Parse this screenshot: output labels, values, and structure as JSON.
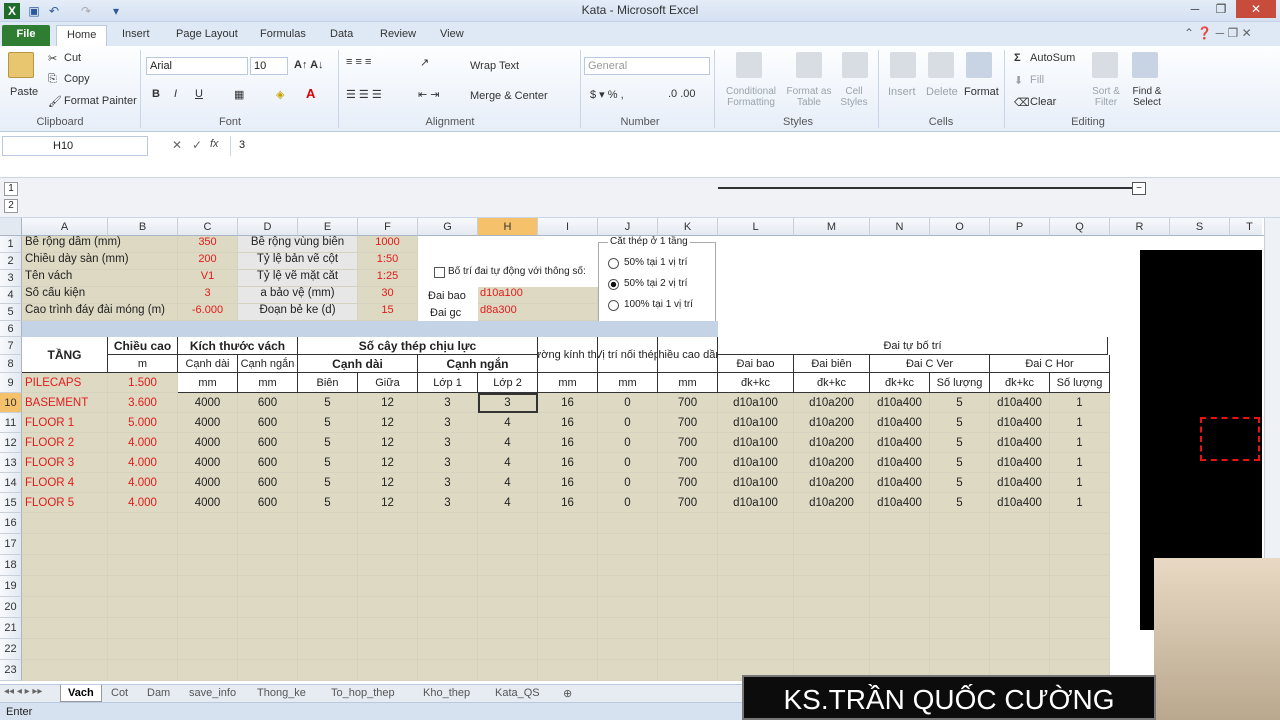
{
  "window": {
    "title": "Kata - Microsoft Excel"
  },
  "ribbon_tabs": [
    "File",
    "Home",
    "Insert",
    "Page Layout",
    "Formulas",
    "Data",
    "Review",
    "View"
  ],
  "clipboard": {
    "paste": "Paste",
    "cut": "Cut",
    "copy": "Copy",
    "format_painter": "Format Painter",
    "label": "Clipboard"
  },
  "font": {
    "name": "Arial",
    "size": "10",
    "label": "Font"
  },
  "alignment": {
    "wrap": "Wrap Text",
    "merge": "Merge & Center",
    "label": "Alignment"
  },
  "number": {
    "format": "General",
    "label": "Number"
  },
  "styles": {
    "conditional": "Conditional Formatting",
    "table": "Format as Table",
    "cell": "Cell Styles",
    "label": "Styles"
  },
  "cells": {
    "insert": "Insert",
    "delete": "Delete",
    "format": "Format",
    "label": "Cells"
  },
  "editing": {
    "autosum": "AutoSum",
    "fill": "Fill",
    "clear": "Clear",
    "sort": "Sort & Filter",
    "find": "Find & Select",
    "label": "Editing"
  },
  "formula_bar": {
    "name_box": "H10",
    "value": "3"
  },
  "columns": [
    "A",
    "B",
    "C",
    "D",
    "E",
    "F",
    "G",
    "H",
    "I",
    "J",
    "K",
    "L",
    "M",
    "N",
    "O",
    "P",
    "Q",
    "R",
    "S",
    "T"
  ],
  "params": {
    "rows": [
      {
        "label": "Bề rộng dầm (mm)",
        "val": "350",
        "label2": "Bề rộng vùng biên",
        "val2": "1000"
      },
      {
        "label": "Chiều dày sàn (mm)",
        "val": "200",
        "label2": "Tỷ lệ bản vẽ cột",
        "val2": "1:50"
      },
      {
        "label": "Tên vách",
        "val": "V1",
        "label2": "Tỷ lệ vẽ mặt cắt",
        "val2": "1:25"
      },
      {
        "label": "Số cấu kiện",
        "val": "3",
        "label2": "a bảo vệ (mm)",
        "val2": "30"
      },
      {
        "label": "Cao trình đáy đài móng (m)",
        "val": "-6.000",
        "label2": "Đoạn bẻ ke (d)",
        "val2": "15"
      }
    ],
    "checkbox": "Bố trí đai tự động với thông số:",
    "dai_bao_label": "Đai bao",
    "dai_bao": "d10a100",
    "dai_gc_label": "Đai gc",
    "dai_gc": "d8a300",
    "group_title": "Cắt thép ở 1 tầng",
    "options": [
      "50% tại 1 vị trí",
      "50% tại 2 vị trí",
      "100% tại 1 vị trí"
    ]
  },
  "table_header": {
    "tang": "TẦNG",
    "chieu_cao": "Chiều cao",
    "kich_thuoc": "Kích thước vách",
    "so_cay": "Số cây thép chịu lực",
    "duong_kinh": "Đường kính thép",
    "vi_tri": "Vị trí nối thép",
    "chieu_cao_dam": "Chiều cao dầm",
    "dai_tu": "Đai tự bố trí",
    "canh_dai": "Cạnh dài",
    "canh_ngan": "Cạnh ngắn",
    "dai_bao": "Đai bao",
    "dai_bien": "Đai biên",
    "dai_c_ver": "Đai C Ver",
    "dai_c_hor": "Đai C Hor",
    "m": "m",
    "mm": "mm",
    "bien": "Biên",
    "giua": "Giữa",
    "lop1": "Lớp 1",
    "lop2": "Lớp 2",
    "dkkc": "đk+kc",
    "so_luong": "Số lượng"
  },
  "floors": [
    {
      "name": "PILECAPS",
      "h": "1.500",
      "cd": "",
      "cn": "",
      "bien": "",
      "giua": "",
      "l1": "",
      "l2": "",
      "dk": "",
      "vt": "",
      "hd": "",
      "db": "",
      "dbi": "",
      "cv": "",
      "cvs": "",
      "ch": "",
      "chs": ""
    },
    {
      "name": "BASEMENT",
      "h": "3.600",
      "cd": "4000",
      "cn": "600",
      "bien": "5",
      "giua": "12",
      "l1": "3",
      "l2": "3",
      "dk": "16",
      "vt": "0",
      "hd": "700",
      "db": "d10a100",
      "dbi": "d10a200",
      "cv": "d10a400",
      "cvs": "5",
      "ch": "d10a400",
      "chs": "1"
    },
    {
      "name": "FLOOR 1",
      "h": "5.000",
      "cd": "4000",
      "cn": "600",
      "bien": "5",
      "giua": "12",
      "l1": "3",
      "l2": "4",
      "dk": "16",
      "vt": "0",
      "hd": "700",
      "db": "d10a100",
      "dbi": "d10a200",
      "cv": "d10a400",
      "cvs": "5",
      "ch": "d10a400",
      "chs": "1"
    },
    {
      "name": "FLOOR 2",
      "h": "4.000",
      "cd": "4000",
      "cn": "600",
      "bien": "5",
      "giua": "12",
      "l1": "3",
      "l2": "4",
      "dk": "16",
      "vt": "0",
      "hd": "700",
      "db": "d10a100",
      "dbi": "d10a200",
      "cv": "d10a400",
      "cvs": "5",
      "ch": "d10a400",
      "chs": "1"
    },
    {
      "name": "FLOOR 3",
      "h": "4.000",
      "cd": "4000",
      "cn": "600",
      "bien": "5",
      "giua": "12",
      "l1": "3",
      "l2": "4",
      "dk": "16",
      "vt": "0",
      "hd": "700",
      "db": "d10a100",
      "dbi": "d10a200",
      "cv": "d10a400",
      "cvs": "5",
      "ch": "d10a400",
      "chs": "1"
    },
    {
      "name": "FLOOR 4",
      "h": "4.000",
      "cd": "4000",
      "cn": "600",
      "bien": "5",
      "giua": "12",
      "l1": "3",
      "l2": "4",
      "dk": "16",
      "vt": "0",
      "hd": "700",
      "db": "d10a100",
      "dbi": "d10a200",
      "cv": "d10a400",
      "cvs": "5",
      "ch": "d10a400",
      "chs": "1"
    },
    {
      "name": "FLOOR 5",
      "h": "4.000",
      "cd": "4000",
      "cn": "600",
      "bien": "5",
      "giua": "12",
      "l1": "3",
      "l2": "4",
      "dk": "16",
      "vt": "0",
      "hd": "700",
      "db": "d10a100",
      "dbi": "d10a200",
      "cv": "d10a400",
      "cvs": "5",
      "ch": "d10a400",
      "chs": "1"
    }
  ],
  "empty_rows": [
    "16",
    "17",
    "18",
    "19",
    "20",
    "21",
    "22",
    "23"
  ],
  "sheet_tabs": [
    "Vach",
    "Cot",
    "Dam",
    "save_info",
    "Thong_ke",
    "To_hop_thep",
    "Kho_thep",
    "Kata_QS"
  ],
  "status": "Enter",
  "banner": "KS.TRẦN QUỐC CƯỜNG"
}
